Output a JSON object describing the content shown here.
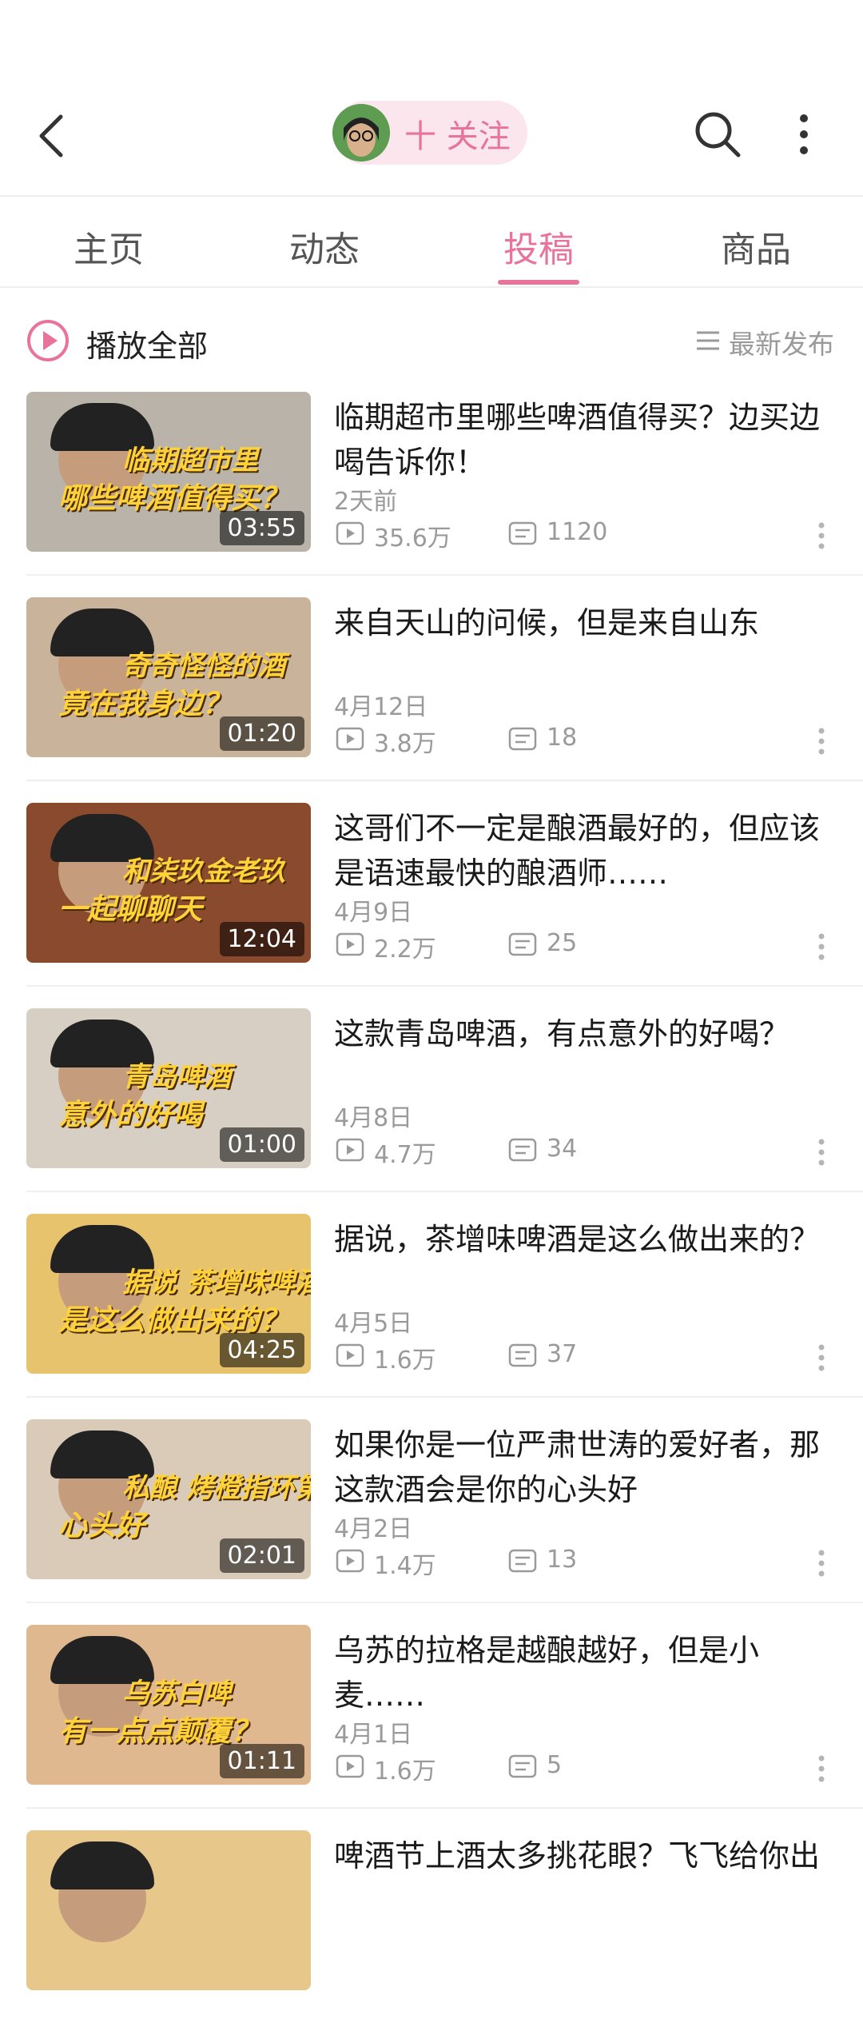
{
  "header": {
    "follow_label": "十 关注",
    "accent_color": "#e8739b"
  },
  "tabs": [
    {
      "label": "主页"
    },
    {
      "label": "动态"
    },
    {
      "label": "投稿",
      "active": true
    },
    {
      "label": "商品"
    }
  ],
  "toolbar": {
    "play_all_label": "播放全部",
    "sort_label": "最新发布"
  },
  "videos": [
    {
      "title": "临期超市里哪些啤酒值得买？边买边喝告诉你！",
      "date": "2天前",
      "views": "35.6万",
      "danmaku": "1120",
      "duration": "03:55",
      "thumb_text_1": "临期超市里",
      "thumb_text_2": "哪些啤酒值得买？",
      "thumb_bg": "#b9b3aa"
    },
    {
      "title": "来自天山的问候，但是来自山东",
      "date": "4月12日",
      "views": "3.8万",
      "danmaku": "18",
      "duration": "01:20",
      "thumb_text_1": "奇奇怪怪的酒",
      "thumb_text_2": "竟在我身边？",
      "thumb_bg": "#c9b39a"
    },
    {
      "title": "这哥们不一定是酿酒最好的，但应该是语速最快的酿酒师……",
      "date": "4月9日",
      "views": "2.2万",
      "danmaku": "25",
      "duration": "12:04",
      "thumb_text_1": "和柒玖金老玖",
      "thumb_text_2": "一起聊聊天",
      "thumb_bg": "#8a4a2e"
    },
    {
      "title": "这款青岛啤酒，有点意外的好喝？",
      "date": "4月8日",
      "views": "4.7万",
      "danmaku": "34",
      "duration": "01:00",
      "thumb_text_1": "青岛啤酒",
      "thumb_text_2": "意外的好喝",
      "thumb_bg": "#d8cfc4"
    },
    {
      "title": "据说，茶增味啤酒是这么做出来的？",
      "date": "4月5日",
      "views": "1.6万",
      "danmaku": "37",
      "duration": "04:25",
      "thumb_text_1": "据说 茶增味啤酒",
      "thumb_text_2": "是这么做出来的？",
      "thumb_bg": "#e7c36d"
    },
    {
      "title": "如果你是一位严肃世涛的爱好者，那这款酒会是你的心头好",
      "date": "4月2日",
      "views": "1.4万",
      "danmaku": "13",
      "duration": "02:01",
      "thumb_text_1": "私酿 烤橙指环第三版",
      "thumb_text_2": "心头好",
      "thumb_bg": "#d9cbb8"
    },
    {
      "title": "乌苏的拉格是越酿越好，但是小麦……",
      "date": "4月1日",
      "views": "1.6万",
      "danmaku": "5",
      "duration": "01:11",
      "thumb_text_1": "乌苏白啤",
      "thumb_text_2": "有一点点颠覆？",
      "thumb_bg": "#e0b88f"
    },
    {
      "title": "啤酒节上酒太多挑花眼？飞飞给你出",
      "date": "",
      "views": "",
      "danmaku": "",
      "duration": "",
      "thumb_text_1": "",
      "thumb_text_2": "",
      "thumb_bg": "#e8c88a"
    }
  ]
}
